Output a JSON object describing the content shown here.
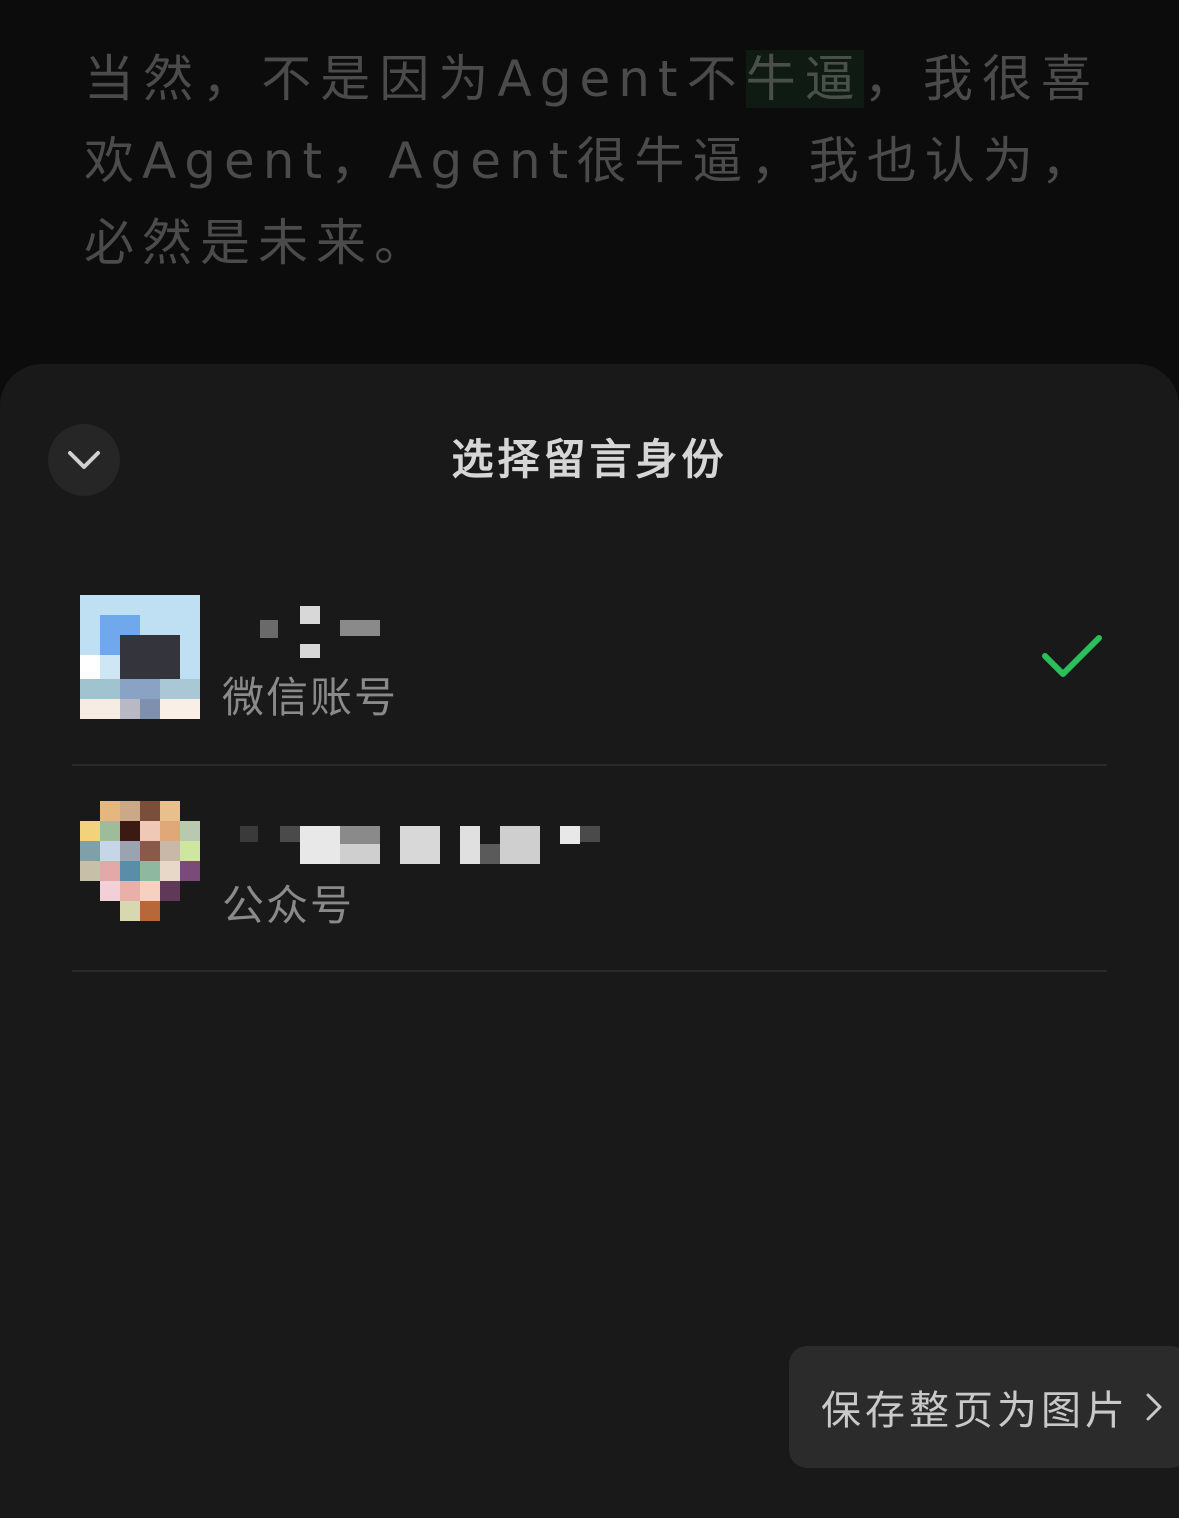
{
  "article": {
    "text_before": "当然，不是因为Agent不",
    "text_highlight": "牛逼",
    "text_after": "，我很喜欢Agent，Agent很牛逼，我也认为，必然是未来。"
  },
  "sheet": {
    "title": "选择留言身份",
    "collapse_icon": "chevron-down-icon",
    "identities": [
      {
        "name": "",
        "type_label": "微信账号",
        "selected": true
      },
      {
        "name": "",
        "type_label": "公众号",
        "selected": false
      }
    ]
  },
  "save_page": {
    "label": "保存整页为图片",
    "icon": "chevron-right-icon"
  },
  "colors": {
    "accent_check": "#2bbf5a",
    "sheet_bg": "#191919",
    "page_bg": "#0c0c0c"
  }
}
